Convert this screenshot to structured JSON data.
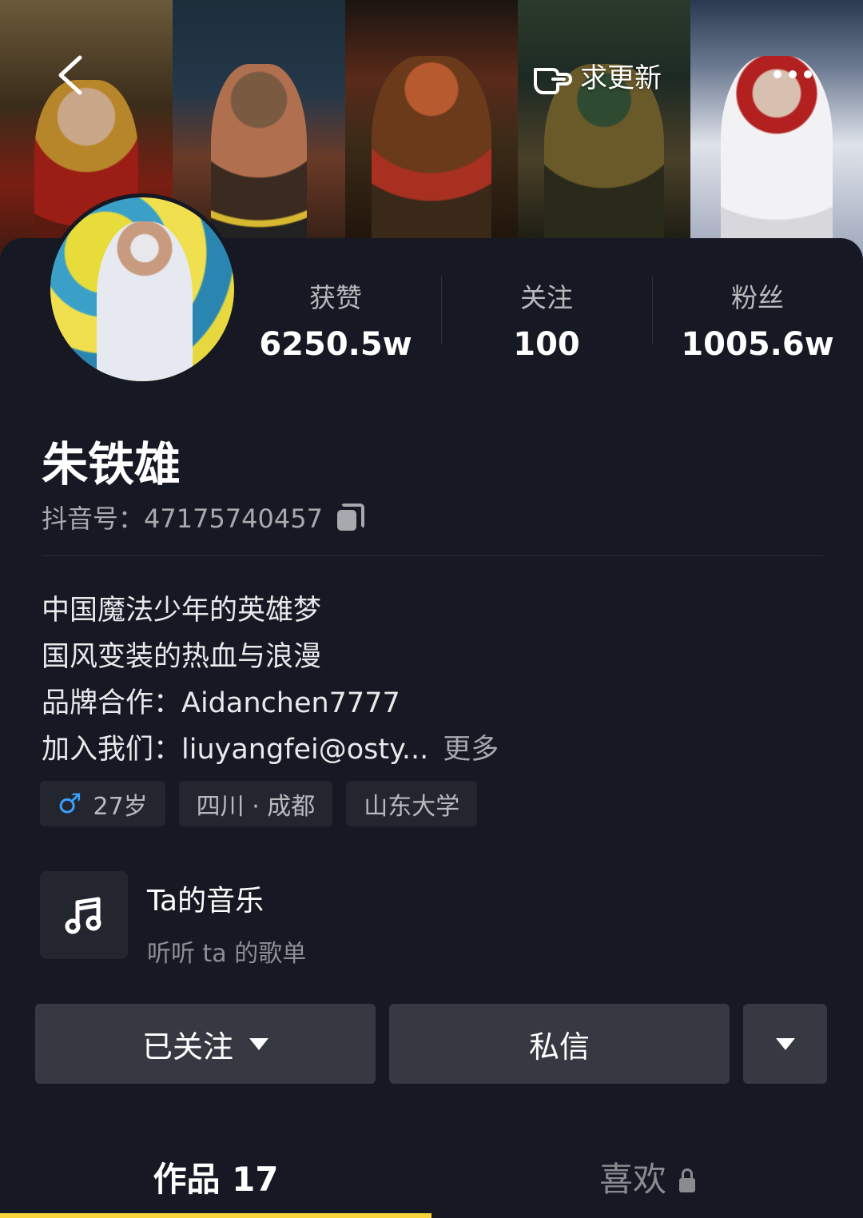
{
  "header": {
    "request_update_label": "求更新"
  },
  "stats": [
    {
      "label": "获赞",
      "value": "6250.5w"
    },
    {
      "label": "关注",
      "value": "100"
    },
    {
      "label": "粉丝",
      "value": "1005.6w"
    }
  ],
  "profile": {
    "name": "朱铁雄",
    "douyin_id": "抖音号：47175740457",
    "bio": [
      "中国魔法少年的英雄梦",
      "国风变装的热血与浪漫",
      "品牌合作：Aidanchen7777",
      "加入我们：liuyangfei@osty..."
    ],
    "more_label": "更多",
    "tags": {
      "age": "27岁",
      "location": "四川 · 成都",
      "school": "山东大学"
    }
  },
  "music": {
    "title": "Ta的音乐",
    "subtitle": "听听 ta 的歌单"
  },
  "actions": {
    "follow_label": "已关注",
    "message_label": "私信"
  },
  "tabs": {
    "works": "作品 17",
    "likes": "喜欢"
  },
  "colors": {
    "background": "#161823",
    "accent": "#f7d33a",
    "button": "#363842",
    "tag_bg": "#24262f",
    "male": "#3aa0ff"
  }
}
